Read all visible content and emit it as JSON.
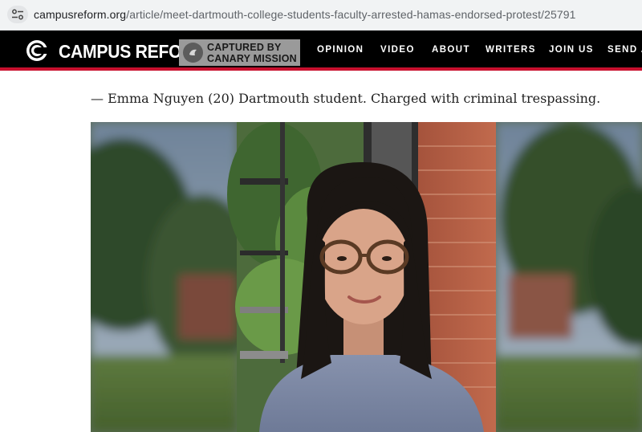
{
  "browser": {
    "url_host": "campusreform.org",
    "url_path": "/article/meet-dartmouth-college-students-faculty-arrested-hamas-endorsed-protest/25791",
    "site_info_icon": "tune-icon"
  },
  "nav": {
    "logo_text": "CAMPUS REFORM",
    "logo_icon": "campus-reform-c-icon",
    "canary_line1": "CAPTURED BY",
    "canary_line2": "CANARY MISSION",
    "links": [
      "OPINION",
      "VIDEO",
      "ABOUT",
      "WRITERS",
      "JOIN US",
      "SEND A"
    ],
    "accent_color": "#c8102e",
    "background_color": "#000000"
  },
  "article": {
    "caption": "— Emma Nguyen (20) Dartmouth student. Charged with criminal trespassing.",
    "photo_subject": "portrait photo"
  }
}
